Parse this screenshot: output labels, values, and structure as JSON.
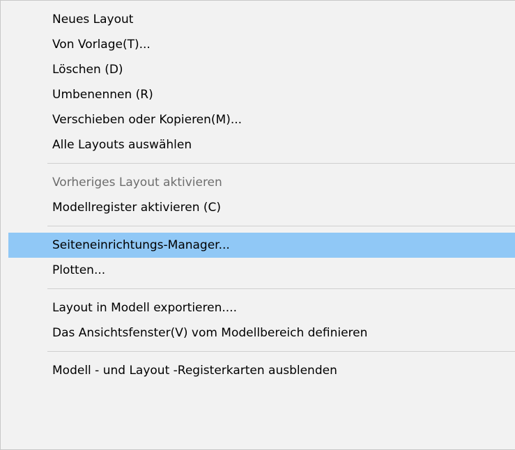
{
  "menu": {
    "groups": [
      {
        "items": [
          {
            "label": "Neues Layout"
          },
          {
            "label": "Von Vorlage(T)..."
          },
          {
            "label": "Löschen (D)"
          },
          {
            "label": "Umbenennen (R)"
          },
          {
            "label": "Verschieben oder Kopieren(M)..."
          },
          {
            "label": "Alle Layouts auswählen"
          }
        ]
      },
      {
        "items": [
          {
            "label": "Vorheriges Layout aktivieren",
            "state": "disabled"
          },
          {
            "label": "Modellregister aktivieren (C)"
          }
        ]
      },
      {
        "items": [
          {
            "label": "Seiteneinrichtungs-Manager...",
            "state": "highlighted"
          },
          {
            "label": "Plotten..."
          }
        ]
      },
      {
        "items": [
          {
            "label": "Layout in Modell exportieren...."
          },
          {
            "label": "Das Ansichtsfenster(V) vom Modellbereich definieren"
          }
        ]
      },
      {
        "items": [
          {
            "label": "Modell - und Layout -Registerkarten ausblenden"
          }
        ]
      }
    ],
    "colors": {
      "highlight": "#90c8f6",
      "background": "#f2f2f2",
      "disabled_text": "#6d6d6d",
      "separator": "#cfcfcf"
    }
  }
}
